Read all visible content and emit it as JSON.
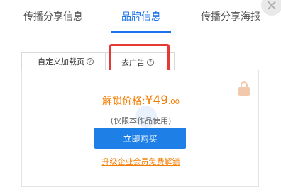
{
  "top_tabs": [
    {
      "label": "传播分享信息"
    },
    {
      "label": "品牌信息"
    },
    {
      "label": "传播分享海报"
    }
  ],
  "close_label": "×",
  "sub_tabs": [
    {
      "label": "自定义加载页"
    },
    {
      "label": "去广告"
    }
  ],
  "help_glyph": "?",
  "panel": {
    "price_label": "解锁价格:",
    "price_main": "¥49",
    "price_decimal": ".00",
    "note": "(仅限本作品使用)",
    "buy_button": "立即购买",
    "upgrade_link": "升级企业会员免费解锁"
  },
  "colors": {
    "accent": "#1a73e8",
    "price": "#f57c00",
    "highlight": "#e53935"
  }
}
